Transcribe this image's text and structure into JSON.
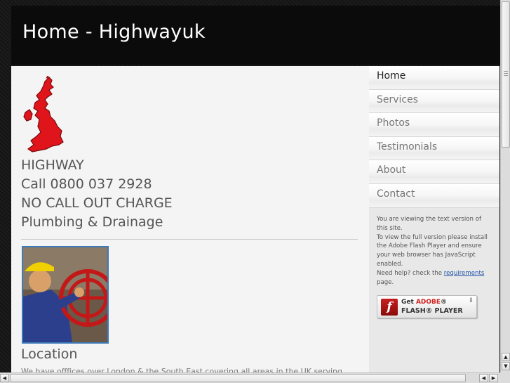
{
  "header": {
    "title": "Home - Highwayuk"
  },
  "main": {
    "lines": [
      "HIGHWAY",
      "Call 0800 037 2928",
      "NO CALL OUT CHARGE",
      "Plumbing & Drainage"
    ],
    "section_heading": "Location",
    "section_text": "We have offfices over London & the South East covering all areas in the UK serving"
  },
  "sidebar": {
    "nav": [
      {
        "label": "Home",
        "active": true
      },
      {
        "label": "Services",
        "active": false
      },
      {
        "label": "Photos",
        "active": false
      },
      {
        "label": "Testimonials",
        "active": false
      },
      {
        "label": "About",
        "active": false
      },
      {
        "label": "Contact",
        "active": false
      }
    ],
    "flash_note": {
      "line1": "You are viewing the text version of this site.",
      "line2": "To view the full version please install the Adobe Flash Player and ensure your web browser has JavaScript enabled.",
      "help_prefix": "Need help? check the ",
      "link": "requirements",
      "help_suffix": " page."
    },
    "flash_badge": {
      "get": "Get ",
      "adobe": "ADOBE",
      "reg": "®",
      "product": "FLASH® PLAYER"
    }
  },
  "colors": {
    "header_bg": "#0b0b0b",
    "content_bg": "#f4f4f4",
    "map_red": "#e0141b",
    "link": "#2255aa"
  }
}
